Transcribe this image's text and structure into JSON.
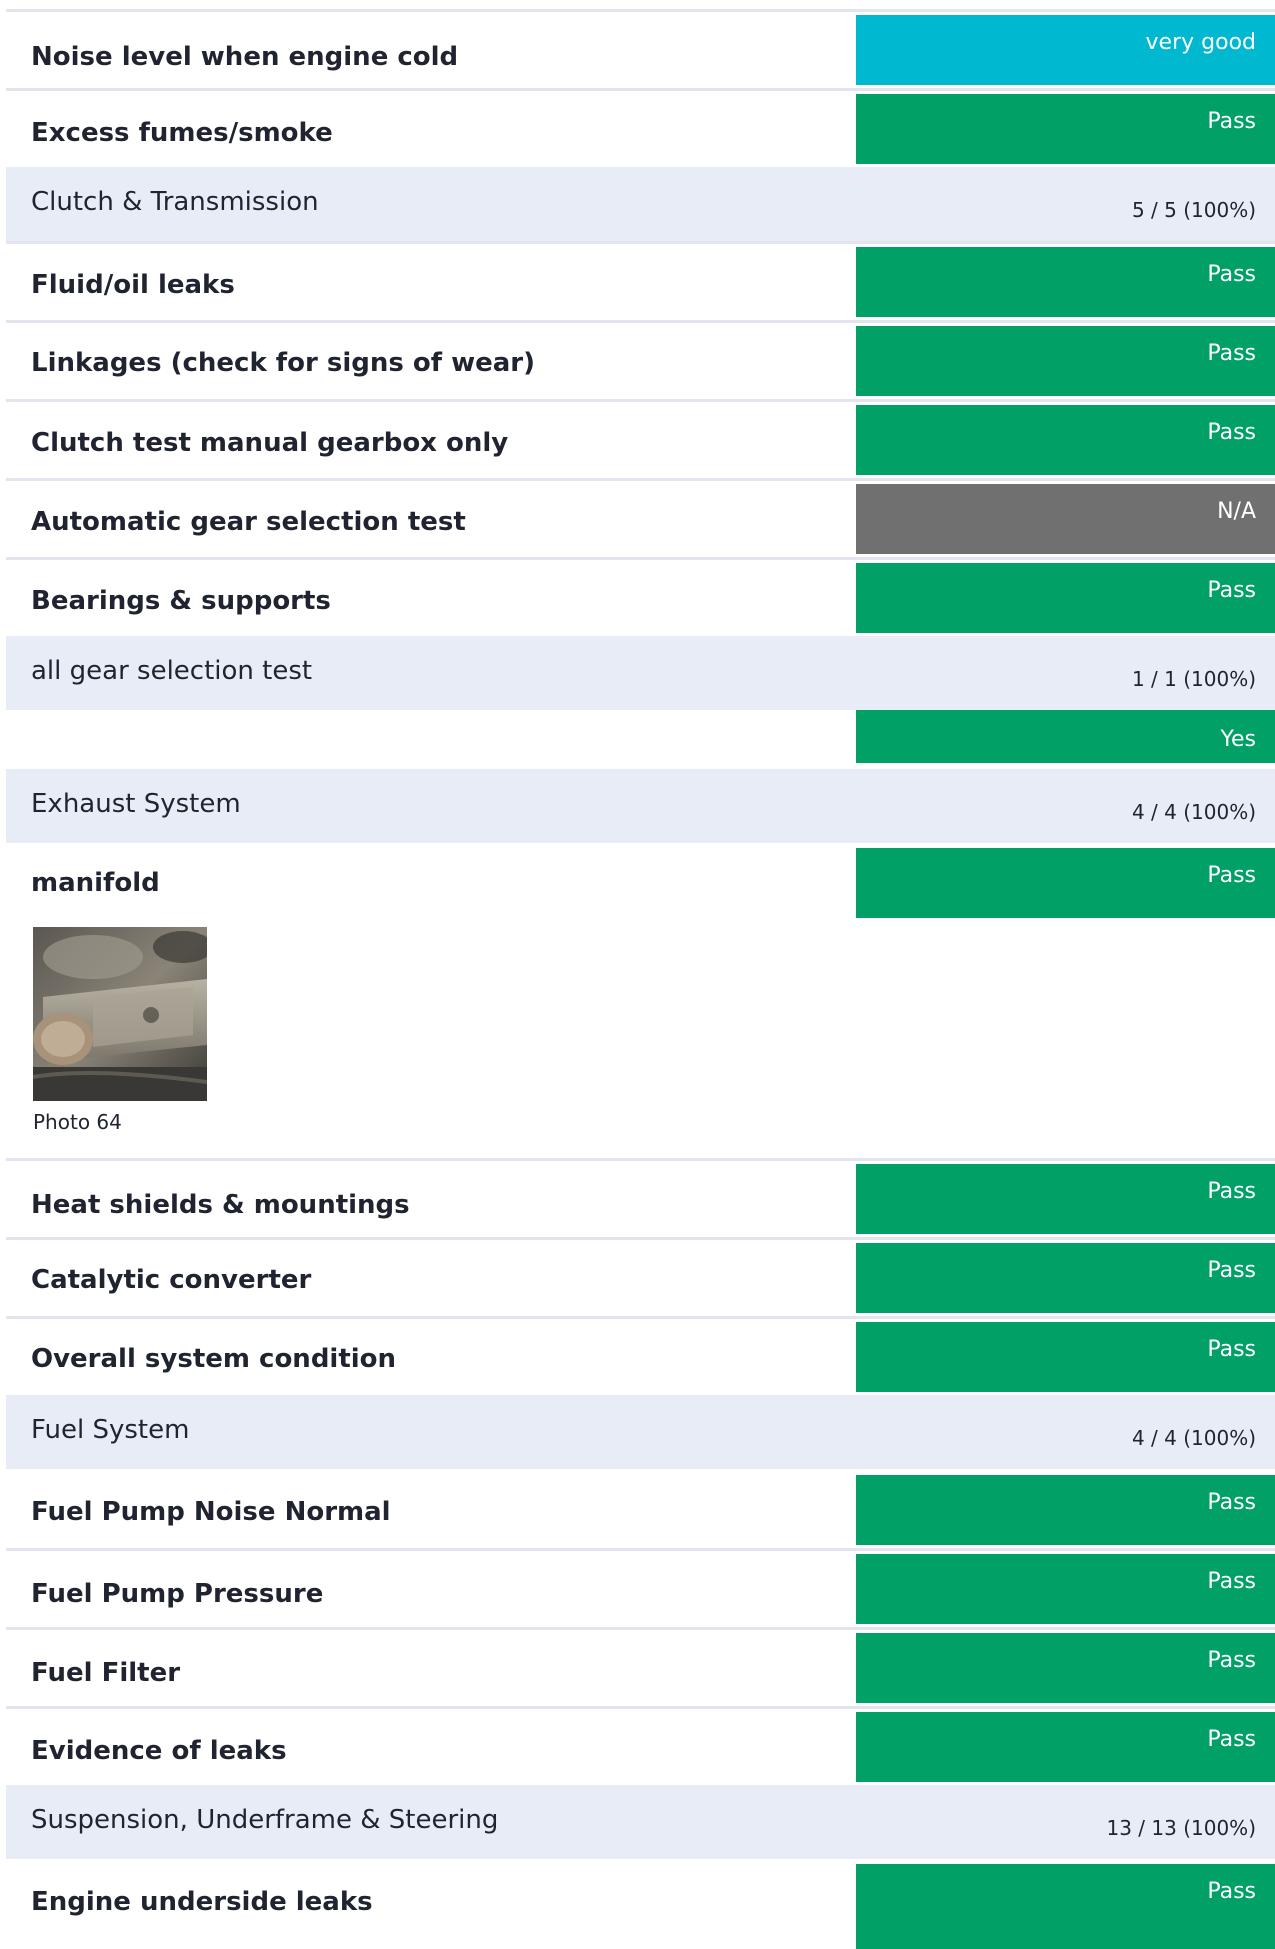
{
  "colors": {
    "pass": "#00a066",
    "very_good": "#00b8d0",
    "na": "#707070",
    "yes": "#00a066",
    "section_bg": "#e8ecf6",
    "divider": "#e2e5ee"
  },
  "rows": [
    {
      "label": "Noise level when engine cold",
      "status": "very good"
    },
    {
      "label": "Excess fumes/smoke",
      "status": "Pass"
    },
    {
      "section": "Clutch & Transmission",
      "score": "5 / 5 (100%)"
    },
    {
      "label": "Fluid/oil leaks",
      "status": "Pass"
    },
    {
      "label": "Linkages (check for signs of wear)",
      "status": "Pass"
    },
    {
      "label": "Clutch test manual gearbox  only",
      "status": "Pass"
    },
    {
      "label": "Automatic gear selection test",
      "status": "N/A"
    },
    {
      "label": "Bearings & supports",
      "status": "Pass"
    },
    {
      "section": "all gear selection test",
      "score": "1 / 1 (100%)"
    },
    {
      "label": "",
      "status": "Yes"
    },
    {
      "section": "Exhaust System",
      "score": "4 / 4 (100%)"
    },
    {
      "label": "manifold",
      "status": "Pass"
    },
    {
      "photo_caption": "Photo 64"
    },
    {
      "label": "Heat shields & mountings",
      "status": "Pass"
    },
    {
      "label": "Catalytic converter",
      "status": "Pass"
    },
    {
      "label": "Overall system condition",
      "status": "Pass"
    },
    {
      "section": "Fuel System",
      "score": "4 / 4 (100%)"
    },
    {
      "label": "Fuel Pump Noise Normal",
      "status": "Pass"
    },
    {
      "label": "Fuel Pump Pressure",
      "status": "Pass"
    },
    {
      "label": "Fuel Filter",
      "status": "Pass"
    },
    {
      "label": "Evidence of leaks",
      "status": "Pass"
    },
    {
      "section": "Suspension, Underframe & Steering",
      "score": "13 / 13 (100%)"
    },
    {
      "label": "Engine underside leaks",
      "status": "Pass"
    }
  ]
}
